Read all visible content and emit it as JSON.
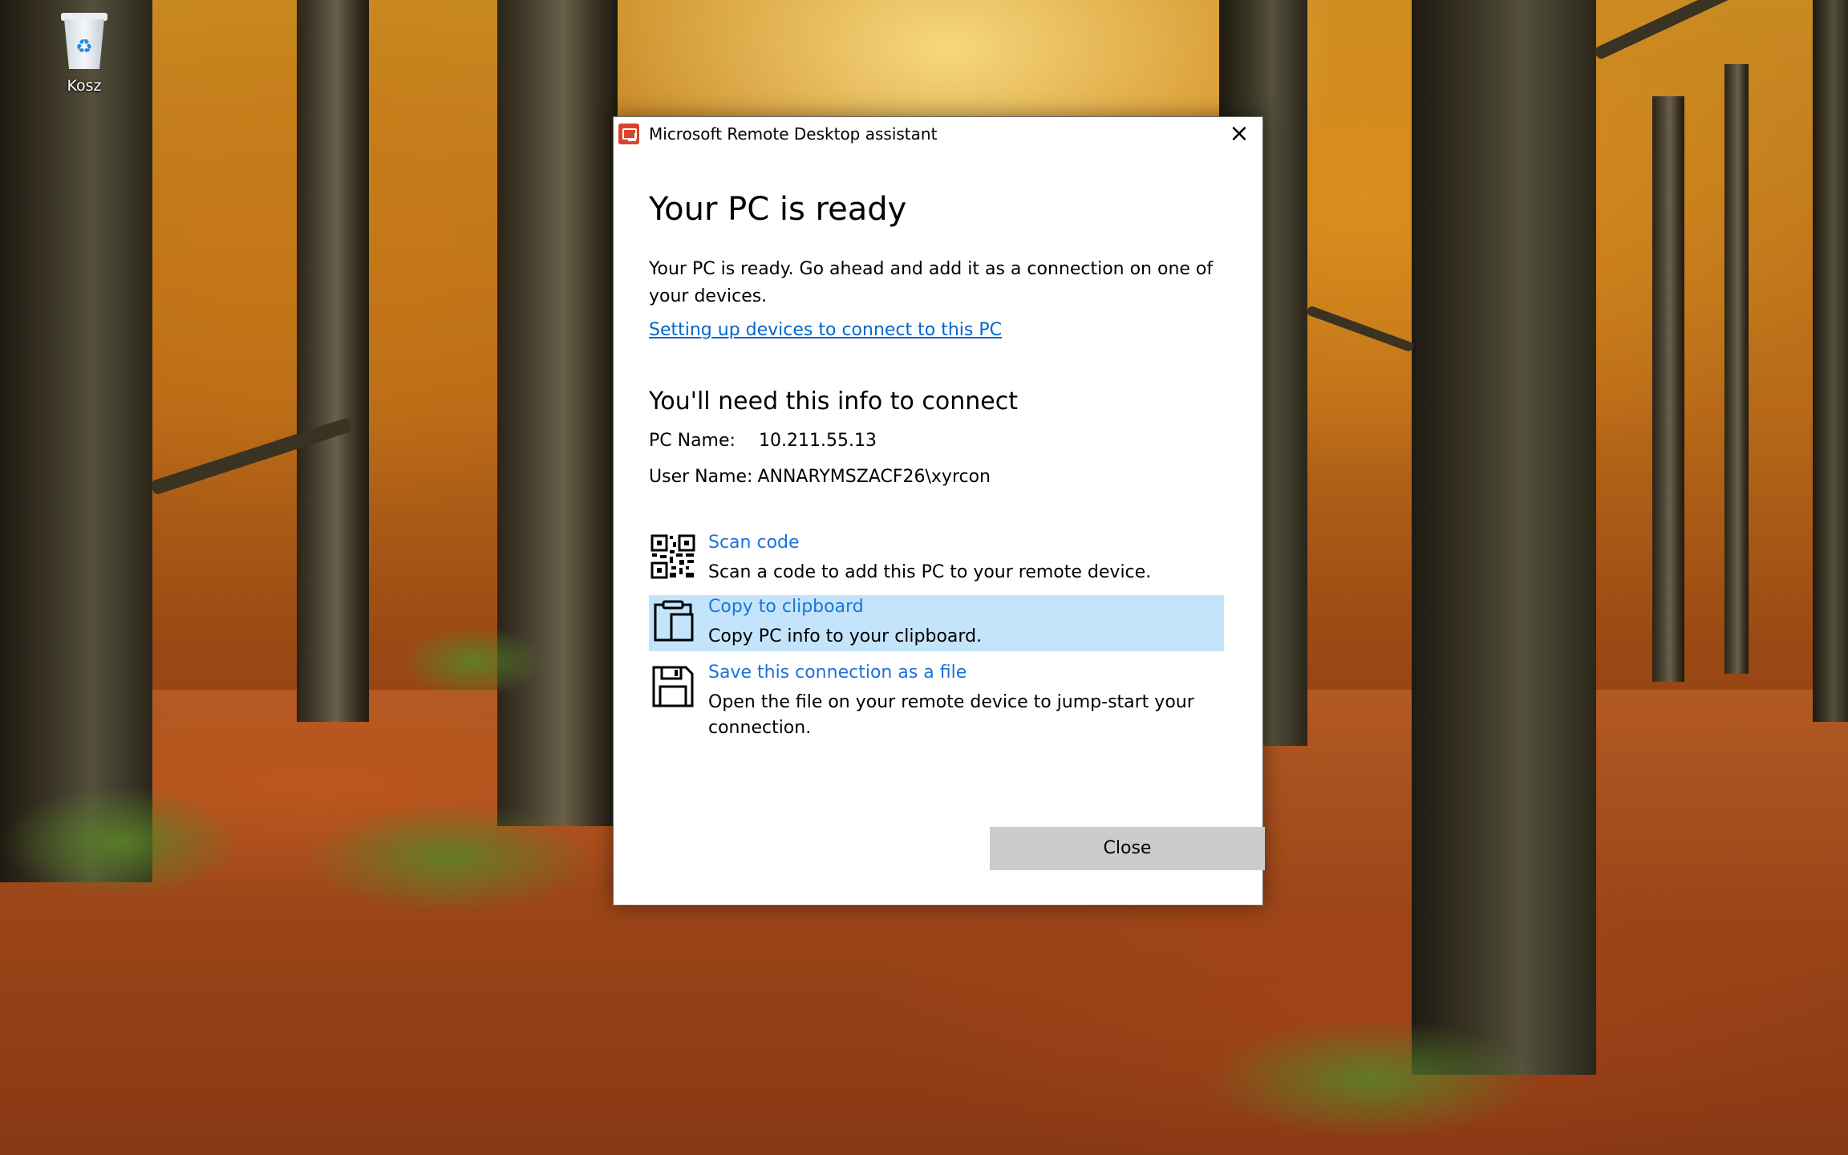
{
  "desktop": {
    "icons": [
      {
        "label": "Kosz",
        "icon": "recycle-bin-icon"
      }
    ]
  },
  "dialog": {
    "title": "Microsoft Remote Desktop assistant",
    "heading": "Your PC is ready",
    "description": "Your PC is ready. Go ahead and add it as a connection on one of your devices.",
    "setup_link": "Setting up devices to connect to this PC",
    "info_heading": "You'll need this info to connect",
    "pc_name_label": "PC Name:",
    "pc_name_value": "10.211.55.13",
    "user_name_label": "User Name:",
    "user_name_value": "ANNARYMSZACF26\\xyrcon",
    "actions": [
      {
        "title": "Scan code",
        "description": "Scan a code to add this PC to your remote device.",
        "icon": "qr-code-icon"
      },
      {
        "title": "Copy to clipboard",
        "description": "Copy PC info to your clipboard.",
        "icon": "clipboard-icon"
      },
      {
        "title": "Save this connection as a file",
        "description": "Open the file on your remote device to jump-start your connection.",
        "icon": "floppy-disk-icon"
      }
    ],
    "close_button": "Close",
    "accent_color": "#1a73d9",
    "highlight_color": "#c4e4fb"
  }
}
